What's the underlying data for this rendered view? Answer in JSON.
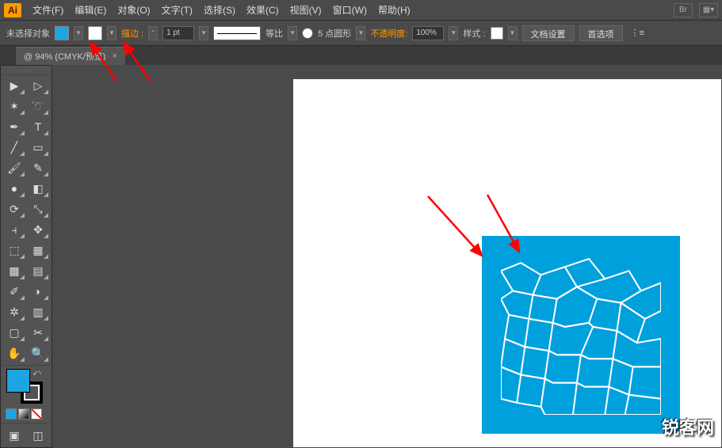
{
  "app": {
    "icon_label": "Ai"
  },
  "menu": {
    "file": "文件(F)",
    "edit": "编辑(E)",
    "object": "对象(O)",
    "type": "文字(T)",
    "select": "选择(S)",
    "effect": "效果(C)",
    "view": "视图(V)",
    "window": "窗口(W)",
    "help": "帮助(H)"
  },
  "menubar_right": {
    "br": "Br",
    "layout": "▦▾"
  },
  "control": {
    "selection_status": "未选择对象",
    "fill_color": "#1da4e2",
    "stroke_color": "#ffffff",
    "stroke_label": "描边 :",
    "stroke_weight": "1 pt",
    "stroke_type_label": "等比",
    "profile_label": "5 点圆形",
    "opacity_label": "不透明度:",
    "opacity_value": "100%",
    "style_label": "样式 :",
    "doc_setup": "文档设置",
    "prefs": "首选项",
    "more_icon": "⋮≡"
  },
  "tab": {
    "title": "@ 94% (CMYK/预览)",
    "close": "×"
  },
  "tools": {
    "row1": [
      "selection-tool",
      "direct-selection-tool"
    ],
    "row2": [
      "magic-wand-tool",
      "lasso-tool"
    ],
    "row3": [
      "pen-tool",
      "type-tool"
    ],
    "row4": [
      "line-tool",
      "rectangle-tool"
    ],
    "row5": [
      "paintbrush-tool",
      "pencil-tool"
    ],
    "row6": [
      "blob-brush-tool",
      "eraser-tool"
    ],
    "row7": [
      "rotate-tool",
      "scale-tool"
    ],
    "row8": [
      "width-tool",
      "free-transform-tool"
    ],
    "row9": [
      "shape-builder-tool",
      "perspective-grid-tool"
    ],
    "row10": [
      "mesh-tool",
      "gradient-tool"
    ],
    "row11": [
      "eyedropper-tool",
      "blend-tool"
    ],
    "row12": [
      "symbol-sprayer-tool",
      "column-graph-tool"
    ],
    "row13": [
      "artboard-tool",
      "slice-tool"
    ],
    "row14": [
      "hand-tool",
      "zoom-tool"
    ]
  },
  "tool_glyphs": {
    "selection-tool": "▶",
    "direct-selection-tool": "▷",
    "magic-wand-tool": "✶",
    "lasso-tool": "➰",
    "pen-tool": "✒",
    "type-tool": "T",
    "line-tool": "╱",
    "rectangle-tool": "▭",
    "paintbrush-tool": "🖌",
    "pencil-tool": "✎",
    "blob-brush-tool": "●",
    "eraser-tool": "◧",
    "rotate-tool": "⟳",
    "scale-tool": "⤡",
    "width-tool": "⫞",
    "free-transform-tool": "✥",
    "shape-builder-tool": "⬚",
    "perspective-grid-tool": "▦",
    "mesh-tool": "▩",
    "gradient-tool": "▤",
    "eyedropper-tool": "✐",
    "blend-tool": "◗",
    "symbol-sprayer-tool": "✲",
    "column-graph-tool": "▥",
    "artboard-tool": "▢",
    "slice-tool": "✂",
    "hand-tool": "✋",
    "zoom-tool": "🔍"
  },
  "fill_stroke": {
    "fill": "#1da4e2",
    "stroke": "#000000"
  },
  "watermark": "锐客网",
  "canvas": {
    "artboard_bg": "#ffffff",
    "square_fill": "#00a0dd",
    "voronoi_stroke": "#ffffff"
  },
  "annotations": {
    "arrow_color": "#ff0000"
  }
}
